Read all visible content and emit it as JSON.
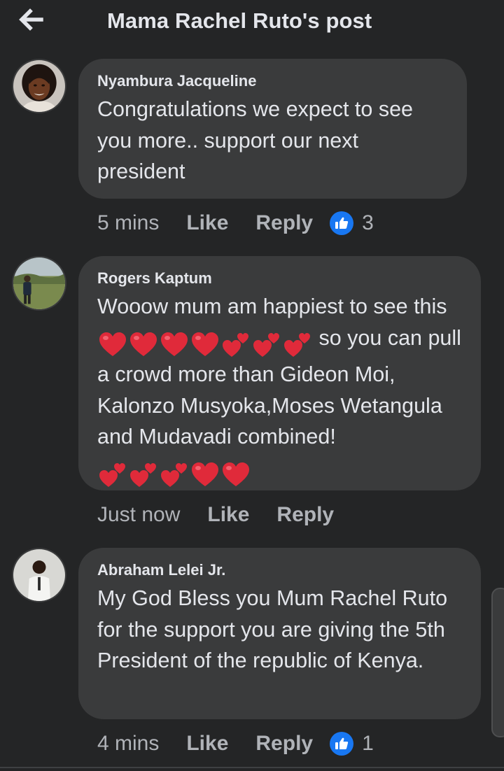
{
  "header": {
    "title": "Mama Rachel Ruto's post",
    "back_icon": "arrow-left-icon"
  },
  "colors": {
    "background": "#242526",
    "bubble": "#3a3b3c",
    "primary_text": "#e4e6eb",
    "secondary_text": "#b0b3b8",
    "like_blue": "#1877f2",
    "heart_red": "#e02a3a"
  },
  "comments": [
    {
      "author": "Nyambura Jacqueline",
      "text": "Congratulations we expect to see you more.. support our next president",
      "time": "5 mins",
      "like_label": "Like",
      "reply_label": "Reply",
      "reaction_icon": "thumbs-up-icon",
      "reaction_count": "3"
    },
    {
      "author": "Rogers Kaptum",
      "text_part1": "Wooow mum am happiest to see this",
      "text_part2": "so you can pull a crowd more than Gideon Moi, Kalonzo Musyoka,Moses Wetangula and Mudavadi combined!",
      "emoji_sequence_1": [
        "red-heart-icon",
        "red-heart-icon",
        "red-heart-icon",
        "red-heart-icon",
        "two-hearts-icon",
        "two-hearts-icon",
        "two-hearts-icon"
      ],
      "emoji_sequence_2": [
        "two-hearts-icon",
        "two-hearts-icon",
        "two-hearts-icon",
        "red-heart-icon",
        "red-heart-icon"
      ],
      "time": "Just now",
      "like_label": "Like",
      "reply_label": "Reply"
    },
    {
      "author": "Abraham Lelei Jr.",
      "text": "My God Bless you Mum Rachel Ruto for the support you are giving the 5th President of the republic of Kenya.",
      "time": "4 mins",
      "like_label": "Like",
      "reply_label": "Reply",
      "reaction_icon": "thumbs-up-icon",
      "reaction_count": "1"
    }
  ]
}
